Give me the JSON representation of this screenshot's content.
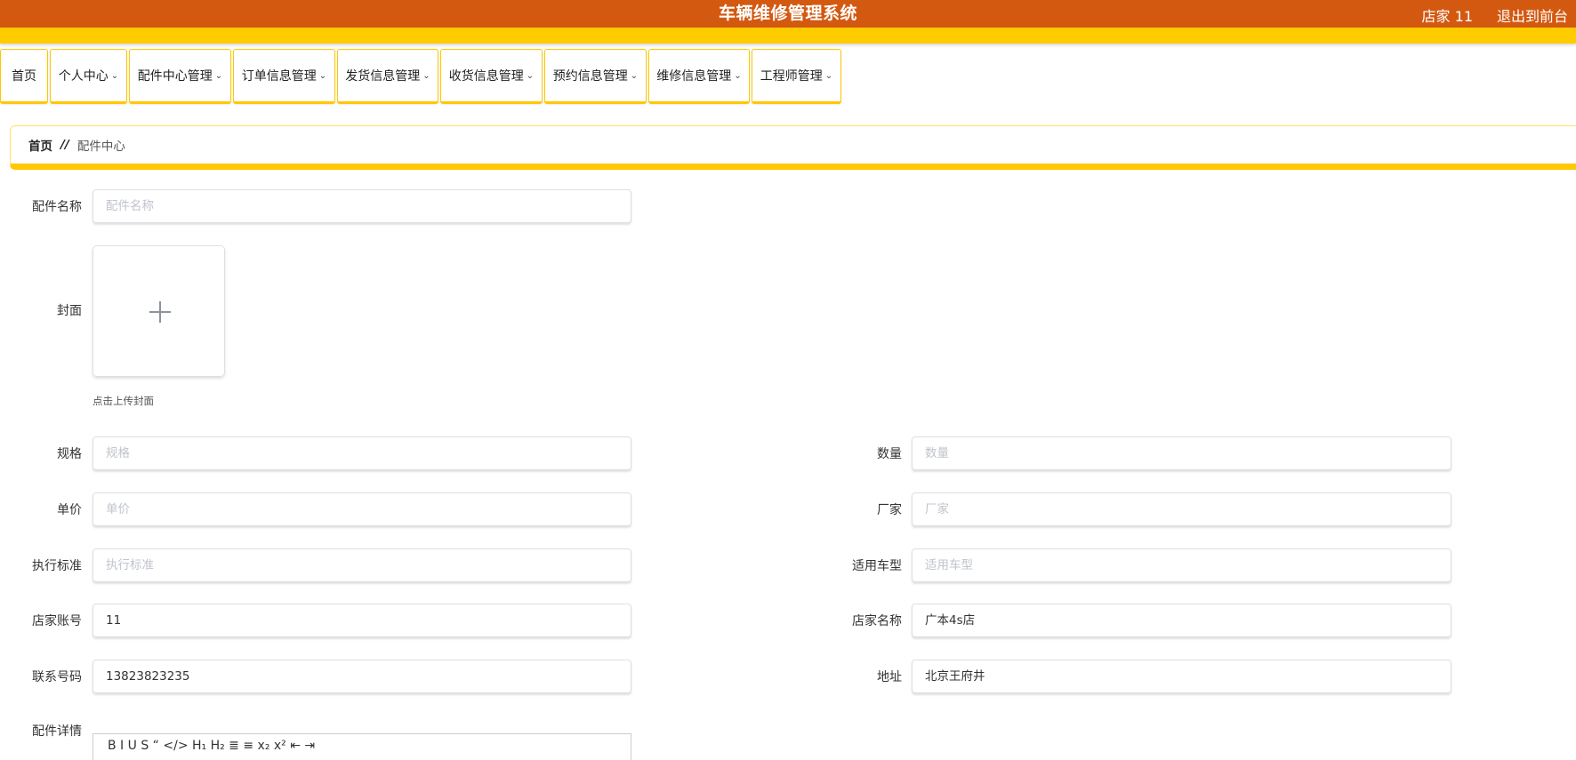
{
  "header": {
    "title": "车辆维修管理系统",
    "user": "店家 11",
    "exit_label": "退出到前台"
  },
  "nav": [
    {
      "label": "首页",
      "has_dropdown": false
    },
    {
      "label": "个人中心",
      "has_dropdown": true
    },
    {
      "label": "配件中心管理",
      "has_dropdown": true
    },
    {
      "label": "订单信息管理",
      "has_dropdown": true
    },
    {
      "label": "发货信息管理",
      "has_dropdown": true
    },
    {
      "label": "收货信息管理",
      "has_dropdown": true
    },
    {
      "label": "预约信息管理",
      "has_dropdown": true
    },
    {
      "label": "维修信息管理",
      "has_dropdown": true
    },
    {
      "label": "工程师管理",
      "has_dropdown": true
    }
  ],
  "breadcrumb": {
    "home": "首页",
    "separator": "//",
    "current": "配件中心"
  },
  "form": {
    "name": {
      "label": "配件名称",
      "value": "",
      "placeholder": "配件名称"
    },
    "cover": {
      "label": "封面",
      "hint": "点击上传封面"
    },
    "spec": {
      "label": "规格",
      "value": "",
      "placeholder": "规格"
    },
    "quantity": {
      "label": "数量",
      "value": "",
      "placeholder": "数量"
    },
    "price": {
      "label": "单价",
      "value": "",
      "placeholder": "单价"
    },
    "manufacturer": {
      "label": "厂家",
      "value": "",
      "placeholder": "厂家"
    },
    "standard": {
      "label": "执行标准",
      "value": "",
      "placeholder": "执行标准"
    },
    "models": {
      "label": "适用车型",
      "value": "",
      "placeholder": "适用车型"
    },
    "shop_account": {
      "label": "店家账号",
      "value": "11",
      "placeholder": ""
    },
    "shop_name": {
      "label": "店家名称",
      "value": "广本4s店",
      "placeholder": ""
    },
    "phone": {
      "label": "联系号码",
      "value": "13823823235",
      "placeholder": ""
    },
    "address": {
      "label": "地址",
      "value": "北京王府井",
      "placeholder": ""
    },
    "detail": {
      "label": "配件详情",
      "toolbar_text": "B  I  U  S  “  </>  H₁  H₂  ≣  ≡  x₂  x²  ⇤  ⇥"
    }
  },
  "colors": {
    "header_bg": "#d35911",
    "accent": "#ffcc00",
    "placeholder": "#c0c4cc"
  }
}
